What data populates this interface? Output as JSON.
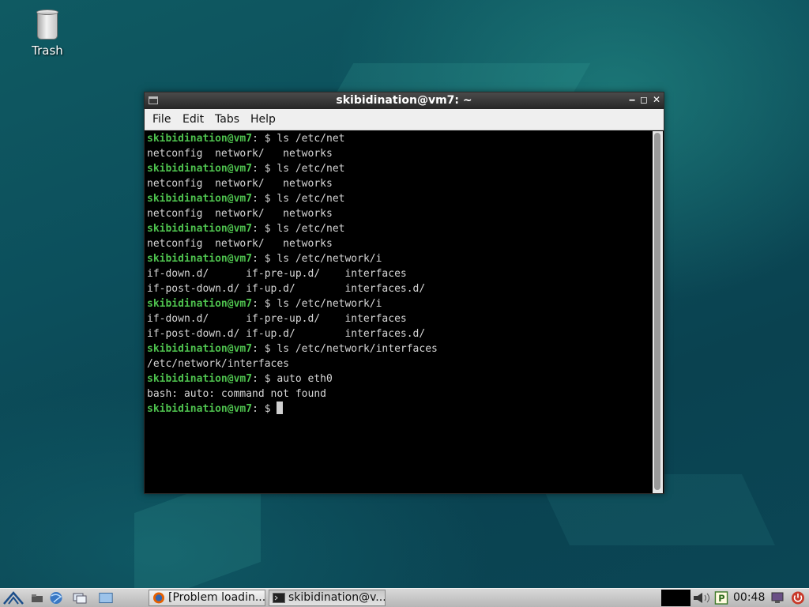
{
  "desktop": {
    "icons": [
      {
        "label": "Trash",
        "icon": "trash-icon"
      }
    ]
  },
  "terminal": {
    "title": "skibidination@vm7: ~",
    "menu": [
      "File",
      "Edit",
      "Tabs",
      "Help"
    ],
    "prompt_user": "skibidination@vm7",
    "prompt_suffix": ": $ ",
    "lines": [
      {
        "type": "prompt",
        "text": "ls /etc/net"
      },
      {
        "type": "out",
        "text": "netconfig  network/   networks"
      },
      {
        "type": "prompt",
        "text": "ls /etc/net"
      },
      {
        "type": "out",
        "text": "netconfig  network/   networks"
      },
      {
        "type": "prompt",
        "text": "ls /etc/net"
      },
      {
        "type": "out",
        "text": "netconfig  network/   networks"
      },
      {
        "type": "prompt",
        "text": "ls /etc/net"
      },
      {
        "type": "out",
        "text": "netconfig  network/   networks"
      },
      {
        "type": "prompt",
        "text": "ls /etc/network/i"
      },
      {
        "type": "out",
        "text": "if-down.d/      if-pre-up.d/    interfaces"
      },
      {
        "type": "out",
        "text": "if-post-down.d/ if-up.d/        interfaces.d/"
      },
      {
        "type": "prompt",
        "text": "ls /etc/network/i"
      },
      {
        "type": "out",
        "text": "if-down.d/      if-pre-up.d/    interfaces"
      },
      {
        "type": "out",
        "text": "if-post-down.d/ if-up.d/        interfaces.d/"
      },
      {
        "type": "prompt",
        "text": "ls /etc/network/interfaces"
      },
      {
        "type": "out",
        "text": "/etc/network/interfaces"
      },
      {
        "type": "prompt",
        "text": "auto eth0"
      },
      {
        "type": "out",
        "text": "bash: auto: command not found"
      },
      {
        "type": "prompt",
        "text": "",
        "cursor": true
      }
    ]
  },
  "taskbar": {
    "launchers": [
      "menu-icon",
      "file-manager-icon",
      "browser-icon",
      "show-desktop-icon",
      "terminal-launcher-icon"
    ],
    "tasks": [
      {
        "label": "[Problem loadin...",
        "icon": "firefox-icon"
      },
      {
        "label": "skibidination@v...",
        "icon": "terminal-icon"
      }
    ],
    "clock": "00:48",
    "tray": [
      "volume-icon",
      "parcellite-icon",
      "network-icon",
      "power-icon"
    ]
  }
}
